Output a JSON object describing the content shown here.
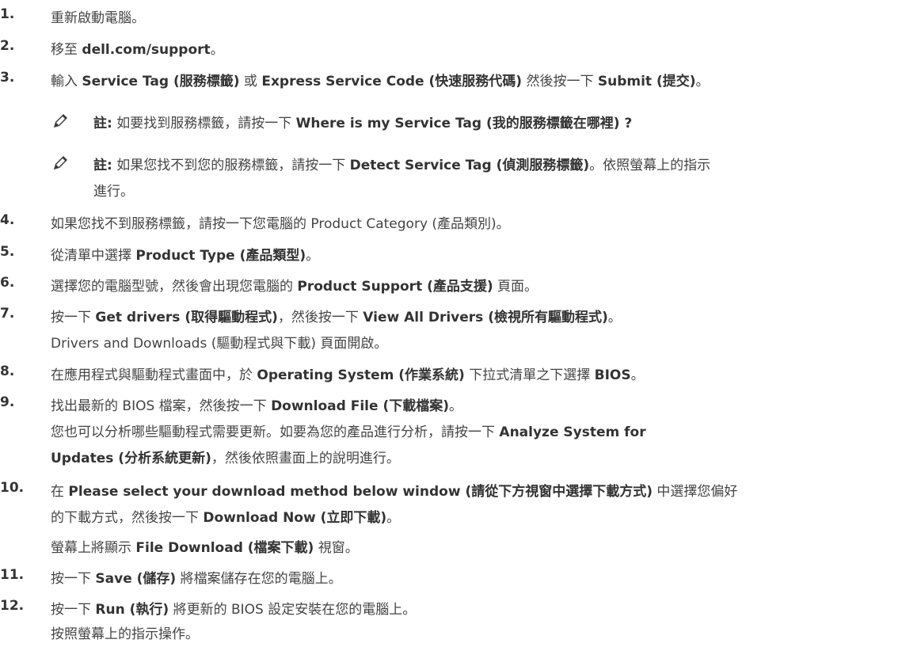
{
  "steps": [
    {
      "num": "1.",
      "parts": [
        {
          "t": "重新啟動電腦。"
        }
      ]
    },
    {
      "num": "2.",
      "parts": [
        {
          "t": "移至 "
        },
        {
          "b": "dell.com/support"
        },
        {
          "t": "。"
        }
      ]
    },
    {
      "num": "3.",
      "parts": [
        {
          "t": "輸入 "
        },
        {
          "b": "Service Tag (服務標籤)"
        },
        {
          "t": " 或 "
        },
        {
          "b": "Express Service Code (快速服務代碼)"
        },
        {
          "t": " 然後按一下 "
        },
        {
          "b": "Submit (提交)"
        },
        {
          "t": "。"
        }
      ]
    },
    {
      "num": "4.",
      "parts": [
        {
          "t": "如果您找不到服務標籤，請按一下您電腦的 Product Category (產品類別)。"
        }
      ]
    },
    {
      "num": "5.",
      "parts": [
        {
          "t": "從清單中選擇 "
        },
        {
          "b": "Product Type (產品類型)"
        },
        {
          "t": "。"
        }
      ]
    },
    {
      "num": "6.",
      "parts": [
        {
          "t": "選擇您的電腦型號，然後會出現您電腦的 "
        },
        {
          "b": "Product Support (產品支援)"
        },
        {
          "t": " 頁面。"
        }
      ]
    },
    {
      "num": "7.",
      "parts": [
        {
          "t": "按一下 "
        },
        {
          "b": "Get drivers (取得驅動程式)"
        },
        {
          "t": "，然後按一下 "
        },
        {
          "b": "View All Drivers (檢視所有驅動程式)"
        },
        {
          "t": "。"
        }
      ],
      "sub": [
        [
          {
            "t": "Drivers and Downloads (驅動程式與下載) 頁面開啟。"
          }
        ]
      ]
    },
    {
      "num": "8.",
      "parts": [
        {
          "t": "在應用程式與驅動程式畫面中，於 "
        },
        {
          "b": "Operating System (作業系統)"
        },
        {
          "t": " 下拉式清單之下選擇 "
        },
        {
          "b": "BIOS"
        },
        {
          "t": "。"
        }
      ]
    },
    {
      "num": "9.",
      "parts": [
        {
          "t": "找出最新的 BIOS 檔案，然後按一下 "
        },
        {
          "b": "Download File (下載檔案)"
        },
        {
          "t": "。"
        }
      ],
      "sub": [
        [
          {
            "t": "您也可以分析哪些驅動程式需要更新。如要為您的產品進行分析，請按一下 "
          },
          {
            "b": "Analyze System for"
          }
        ],
        [
          {
            "b": "Updates (分析系統更新)"
          },
          {
            "t": "，然後依照畫面上的說明進行。"
          }
        ]
      ]
    },
    {
      "num": "10.",
      "parts": [
        {
          "t": "在 "
        },
        {
          "b": "Please select your download method below window (請從下方視窗中選擇下載方式)"
        },
        {
          "t": " 中選擇您偏好"
        }
      ],
      "cont": [
        {
          "t": "的下載方式，然後按一下 "
        },
        {
          "b": "Download Now (立即下載)"
        },
        {
          "t": "。"
        }
      ],
      "sub": [
        [
          {
            "t": "螢幕上將顯示 "
          },
          {
            "b": "File Download (檔案下載)"
          },
          {
            "t": " 視窗。"
          }
        ]
      ]
    },
    {
      "num": "11.",
      "parts": [
        {
          "t": "按一下 "
        },
        {
          "b": "Save (儲存)"
        },
        {
          "t": " 將檔案儲存在您的電腦上。"
        }
      ]
    },
    {
      "num": "12.",
      "parts": [
        {
          "t": "按一下 "
        },
        {
          "b": "Run (執行)"
        },
        {
          "t": " 將更新的 BIOS 設定安裝在您的電腦上。"
        }
      ],
      "sub": [
        [
          {
            "t": "按照螢幕上的指示操作。"
          }
        ]
      ]
    }
  ],
  "notes": [
    {
      "label": "註:",
      "parts": [
        {
          "t": " 如要找到服務標籤，請按一下 "
        },
        {
          "b": "Where is my Service Tag (我的服務標籤在哪裡) ?"
        }
      ]
    },
    {
      "label": "註:",
      "parts": [
        {
          "t": " 如果您找不到您的服務標籤，請按一下 "
        },
        {
          "b": "Detect Service Tag (偵測服務標籤)"
        },
        {
          "t": "。依照螢幕上的指示"
        }
      ],
      "cont": "進行。"
    }
  ]
}
